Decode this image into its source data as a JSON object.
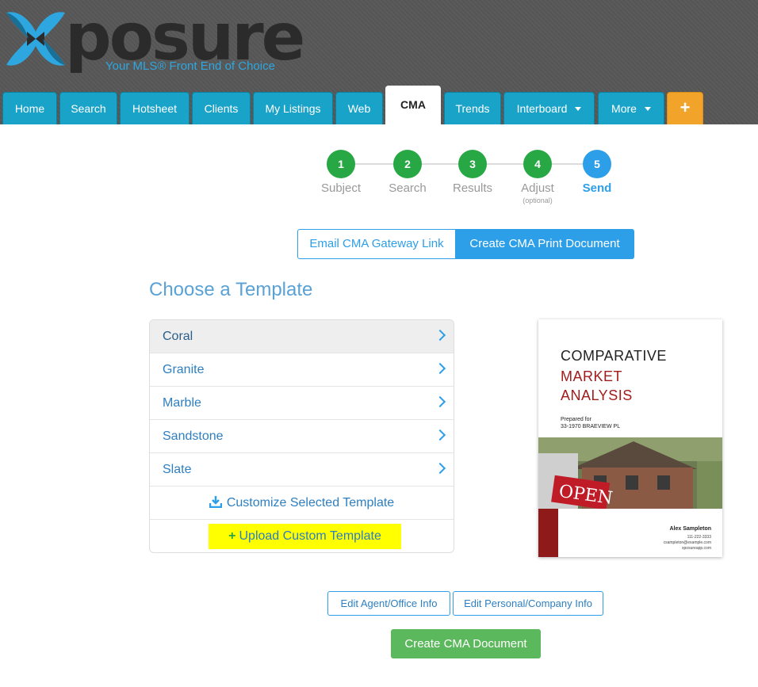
{
  "brand": {
    "logo_text": "posure",
    "tagline": "Your MLS® Front End of Choice"
  },
  "nav": {
    "tabs": [
      {
        "label": "Home"
      },
      {
        "label": "Search"
      },
      {
        "label": "Hotsheet"
      },
      {
        "label": "Clients"
      },
      {
        "label": "My Listings"
      },
      {
        "label": "Web"
      },
      {
        "label": "CMA",
        "active": true
      },
      {
        "label": "Trends"
      },
      {
        "label": "Interboard",
        "dropdown": true
      },
      {
        "label": "More",
        "dropdown": true
      },
      {
        "label": "+"
      }
    ]
  },
  "steps": [
    {
      "number": "1",
      "label": "Subject",
      "state": "done"
    },
    {
      "number": "2",
      "label": "Search",
      "state": "done"
    },
    {
      "number": "3",
      "label": "Results",
      "state": "done"
    },
    {
      "number": "4",
      "label": "Adjust",
      "sub": "(optional)",
      "state": "done"
    },
    {
      "number": "5",
      "label": "Send",
      "state": "current"
    }
  ],
  "send_mode": {
    "email_label": "Email CMA Gateway Link",
    "print_label": "Create CMA Print Document",
    "selected": "print"
  },
  "templates": {
    "title": "Choose a Template",
    "items": [
      {
        "label": "Coral",
        "selected": true
      },
      {
        "label": "Granite"
      },
      {
        "label": "Marble"
      },
      {
        "label": "Sandstone"
      },
      {
        "label": "Slate"
      }
    ],
    "customize_label": "Customize Selected Template",
    "upload_label": "Upload Custom Template"
  },
  "preview": {
    "title_line1": "COMPARATIVE",
    "title_line2": "MARKET",
    "title_line3": "ANALYSIS",
    "prepared_for": "Prepared for",
    "address": "33-1970 BRAEVIEW PL",
    "sign_text": "OPEN",
    "agent_name": "Alex Sampleton",
    "agent_phone": "111-222-3333",
    "agent_email": "csampleton@example.com",
    "agent_site": "xposureapp.com"
  },
  "actions": {
    "edit_agent_office": "Edit Agent/Office Info",
    "edit_personal_company": "Edit Personal/Company Info",
    "create_document": "Create CMA Document"
  },
  "colors": {
    "nav_tab": "#1aa3c8",
    "plus_tab": "#f2a32a",
    "step_done": "#28a745",
    "step_current": "#2d9fe8",
    "primary": "#2d9fe8",
    "success": "#5cb85c",
    "highlight": "#ffff00",
    "preview_accent": "#a11c1c"
  }
}
